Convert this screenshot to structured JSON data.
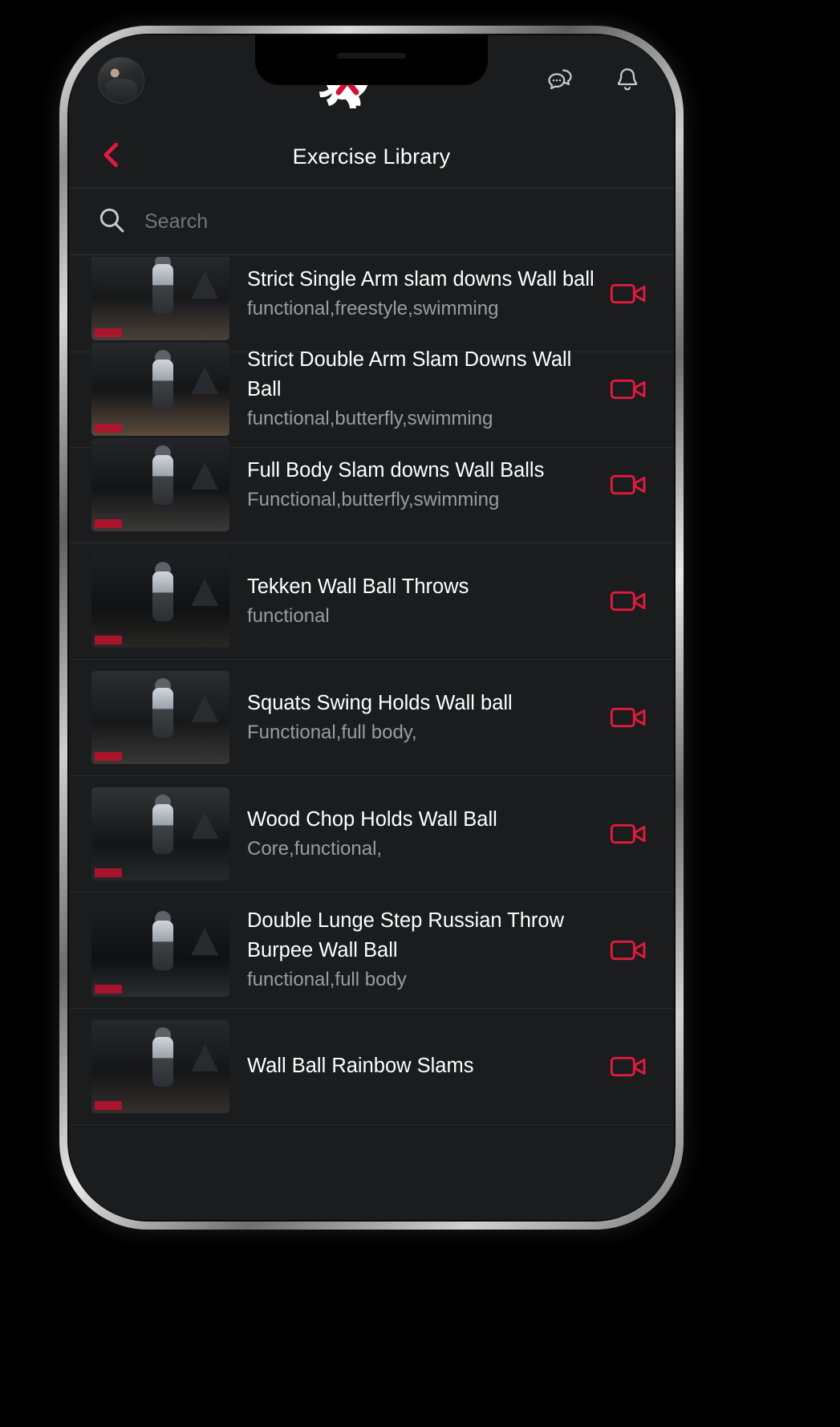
{
  "theme": {
    "accent": "#e01b3c",
    "bg": "#1b1c1e",
    "text_primary": "#ffffff",
    "text_secondary": "#9b9c9f",
    "divider": "#2a2b2d"
  },
  "header": {
    "avatar_name": "user-avatar",
    "logo_name": "bull-x-logo",
    "logo_letter": "X",
    "messages_icon": "chat-bubbles-icon",
    "notifications_icon": "bell-icon"
  },
  "titlebar": {
    "back_icon": "back-chevron-icon",
    "title": "Exercise Library"
  },
  "search": {
    "icon": "search-icon",
    "placeholder": "Search",
    "value": ""
  },
  "list": {
    "video_icon": "video-camera-icon",
    "items": [
      {
        "title": "Strict Single Arm slam downs Wall ball",
        "tags": "functional,freestyle,swimming",
        "clipped": true
      },
      {
        "title": "Strict Double Arm Slam Downs Wall Ball",
        "tags": "functional,butterfly,swimming",
        "clipped": true
      },
      {
        "title": "Full Body Slam downs Wall Balls",
        "tags": "Functional,butterfly,swimming",
        "clipped": true
      },
      {
        "title": "Tekken Wall Ball Throws",
        "tags": "functional",
        "clipped": false
      },
      {
        "title": "Squats Swing Holds Wall ball",
        "tags": "Functional,full body,",
        "clipped": false
      },
      {
        "title": "Wood Chop Holds Wall Ball",
        "tags": "Core,functional,",
        "clipped": false
      },
      {
        "title": "Double Lunge Step Russian Throw Burpee Wall Ball",
        "tags": "functional,full body",
        "clipped": false
      },
      {
        "title": "Wall Ball Rainbow Slams",
        "tags": "",
        "clipped": false
      }
    ]
  }
}
